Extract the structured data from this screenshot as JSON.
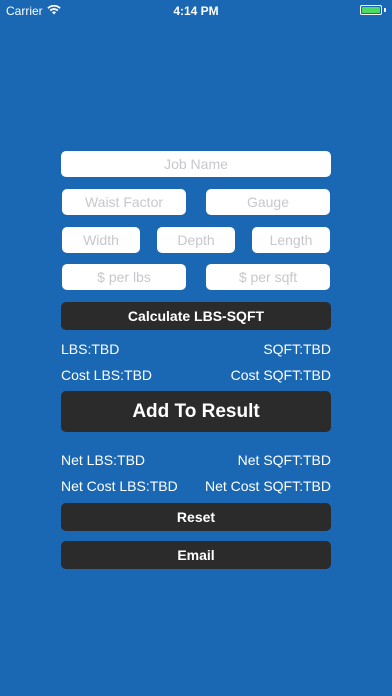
{
  "status_bar": {
    "carrier": "Carrier",
    "time": "4:14 PM",
    "battery_color": "#4cd964"
  },
  "inputs": {
    "job_name": {
      "placeholder": "Job Name",
      "value": ""
    },
    "waist_factor": {
      "placeholder": "Waist Factor",
      "value": ""
    },
    "gauge": {
      "placeholder": "Gauge",
      "value": ""
    },
    "width": {
      "placeholder": "Width",
      "value": ""
    },
    "depth": {
      "placeholder": "Depth",
      "value": ""
    },
    "length": {
      "placeholder": "Length",
      "value": ""
    },
    "price_per_lbs": {
      "placeholder": "$ per lbs",
      "value": ""
    },
    "price_per_sqft": {
      "placeholder": "$ per sqft",
      "value": ""
    }
  },
  "buttons": {
    "calculate": "Calculate LBS-SQFT",
    "add_to_result": "Add To Result",
    "reset": "Reset",
    "email": "Email"
  },
  "results": {
    "lbs": "LBS:TBD",
    "sqft": "SQFT:TBD",
    "cost_lbs": "Cost LBS:TBD",
    "cost_sqft": "Cost SQFT:TBD",
    "net_lbs": "Net LBS:TBD",
    "net_sqft": "Net SQFT:TBD",
    "net_cost_lbs": "Net Cost LBS:TBD",
    "net_cost_sqft": "Net Cost SQFT:TBD"
  },
  "colors": {
    "background": "#1a67b3",
    "button": "#2b2b2c"
  }
}
